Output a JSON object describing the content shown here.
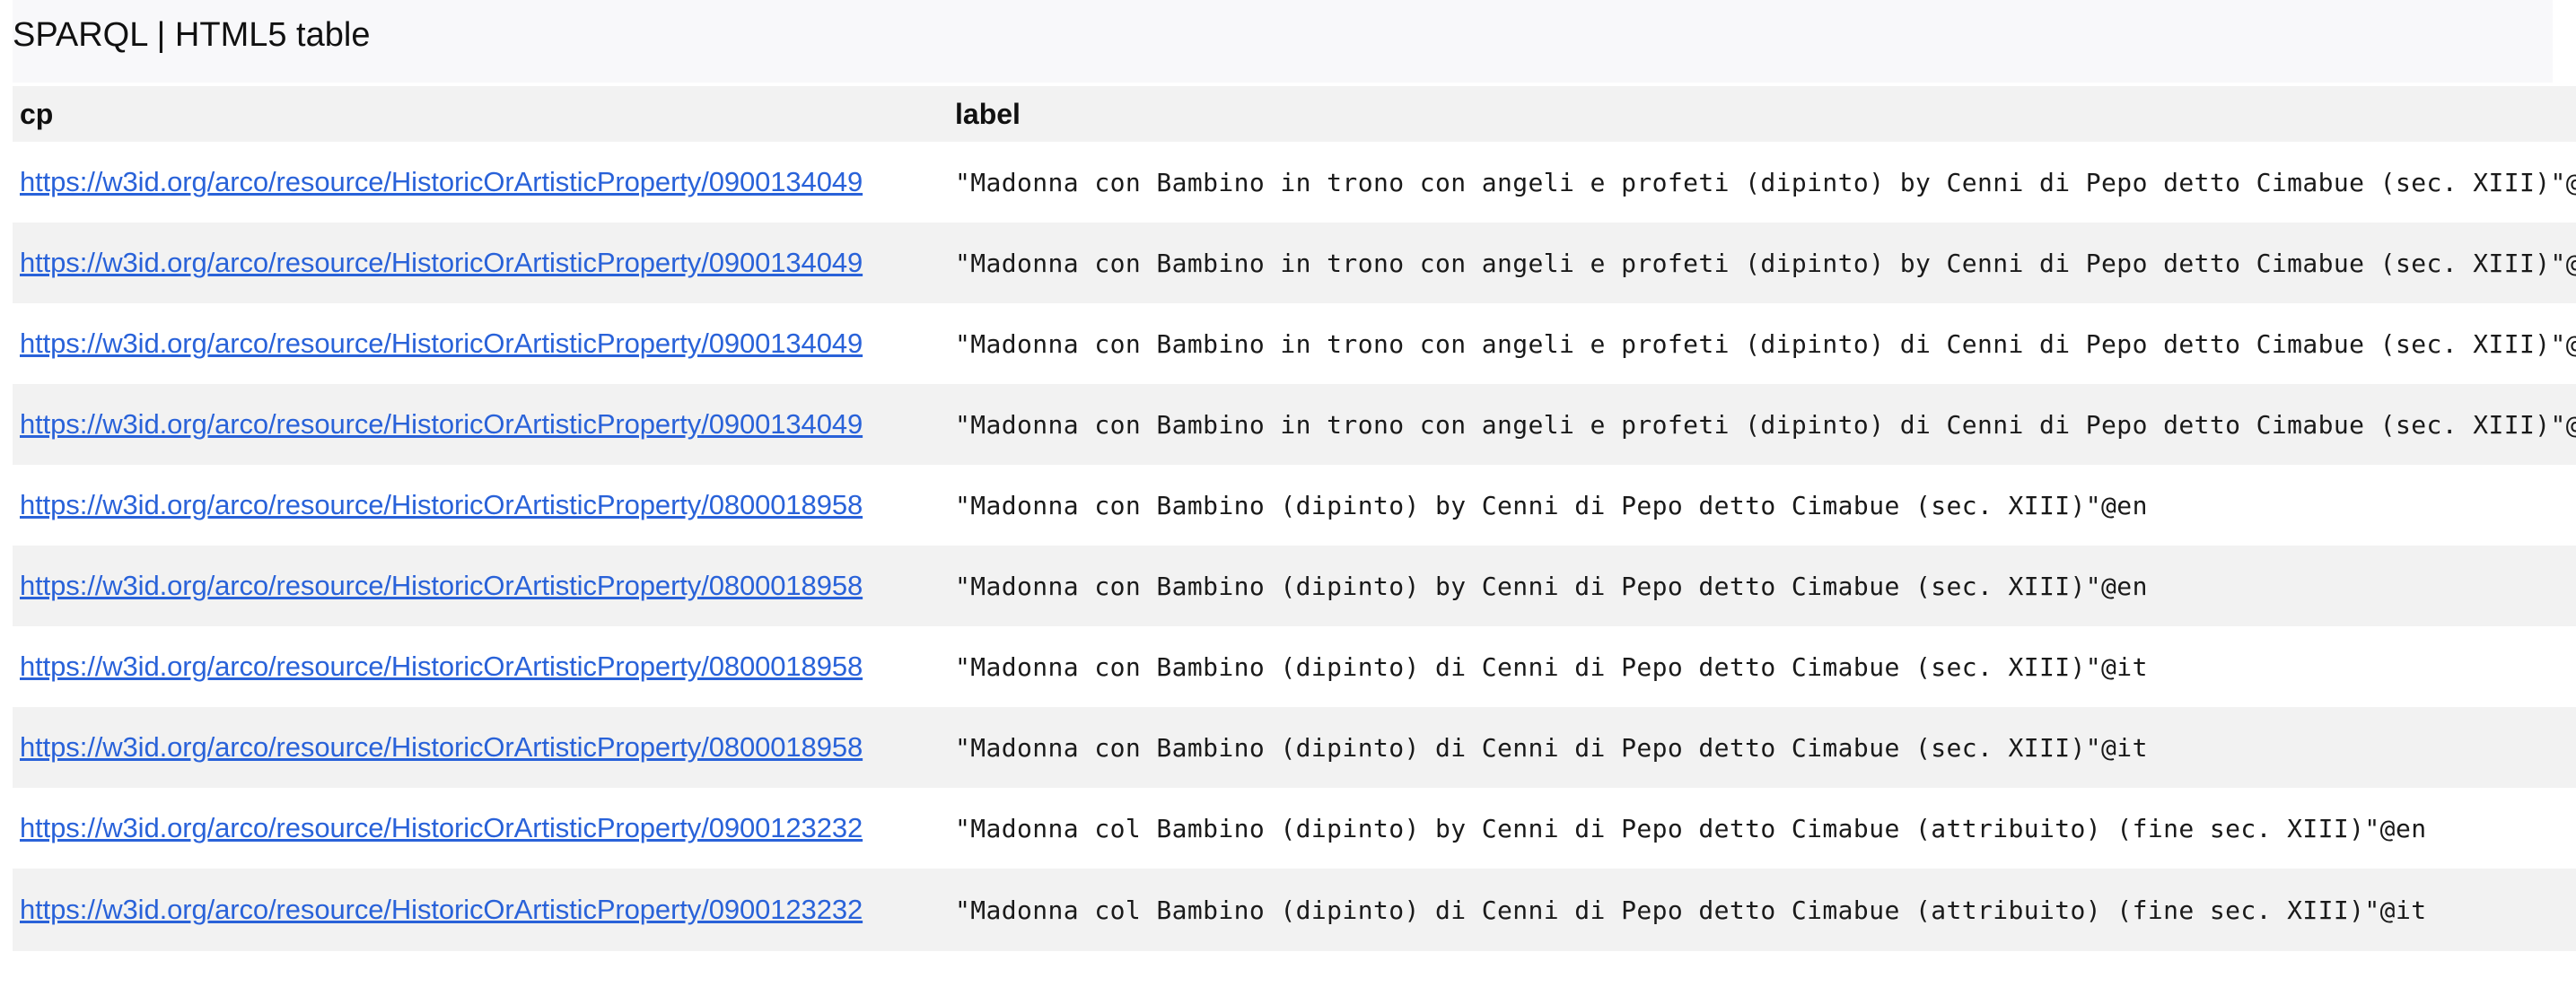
{
  "page": {
    "title": "SPARQL | HTML5 table"
  },
  "table": {
    "columns": [
      "cp",
      "label"
    ],
    "rows": [
      {
        "cp": "https://w3id.org/arco/resource/HistoricOrArtisticProperty/0900134049",
        "label": "\"Madonna con Bambino in trono con angeli e profeti (dipinto) by Cenni di Pepo detto Cimabue (sec. XIII)\"@en"
      },
      {
        "cp": "https://w3id.org/arco/resource/HistoricOrArtisticProperty/0900134049",
        "label": "\"Madonna con Bambino in trono con angeli e profeti (dipinto) by Cenni di Pepo detto Cimabue (sec. XIII)\"@en"
      },
      {
        "cp": "https://w3id.org/arco/resource/HistoricOrArtisticProperty/0900134049",
        "label": "\"Madonna con Bambino in trono con angeli e profeti (dipinto) di Cenni di Pepo detto Cimabue (sec. XIII)\"@it"
      },
      {
        "cp": "https://w3id.org/arco/resource/HistoricOrArtisticProperty/0900134049",
        "label": "\"Madonna con Bambino in trono con angeli e profeti (dipinto) di Cenni di Pepo detto Cimabue (sec. XIII)\"@it"
      },
      {
        "cp": "https://w3id.org/arco/resource/HistoricOrArtisticProperty/0800018958",
        "label": "\"Madonna con Bambino (dipinto) by Cenni di Pepo detto Cimabue (sec. XIII)\"@en"
      },
      {
        "cp": "https://w3id.org/arco/resource/HistoricOrArtisticProperty/0800018958",
        "label": "\"Madonna con Bambino (dipinto) by Cenni di Pepo detto Cimabue (sec. XIII)\"@en"
      },
      {
        "cp": "https://w3id.org/arco/resource/HistoricOrArtisticProperty/0800018958",
        "label": "\"Madonna con Bambino (dipinto) di Cenni di Pepo detto Cimabue (sec. XIII)\"@it"
      },
      {
        "cp": "https://w3id.org/arco/resource/HistoricOrArtisticProperty/0800018958",
        "label": "\"Madonna con Bambino (dipinto) di Cenni di Pepo detto Cimabue (sec. XIII)\"@it"
      },
      {
        "cp": "https://w3id.org/arco/resource/HistoricOrArtisticProperty/0900123232",
        "label": "\"Madonna col Bambino (dipinto) by Cenni di Pepo detto Cimabue (attribuito) (fine sec. XIII)\"@en"
      },
      {
        "cp": "https://w3id.org/arco/resource/HistoricOrArtisticProperty/0900123232",
        "label": "\"Madonna col Bambino (dipinto) di Cenni di Pepo detto Cimabue (attribuito) (fine sec. XIII)\"@it"
      }
    ]
  },
  "colors": {
    "link": "#2962d9",
    "header_bg": "#f2f2f2",
    "stripe_bg": "#f2f2f2",
    "title_bg": "#f8f8fa"
  }
}
